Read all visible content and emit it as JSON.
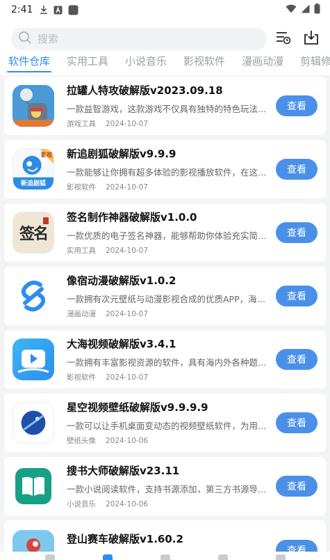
{
  "status": {
    "time": "2:41"
  },
  "search": {
    "placeholder": "搜索"
  },
  "tabs": [
    {
      "label": "软件仓库",
      "active": true
    },
    {
      "label": "实用工具"
    },
    {
      "label": "小说音乐"
    },
    {
      "label": "影视软件"
    },
    {
      "label": "漫画动漫"
    },
    {
      "label": "剪辑修"
    }
  ],
  "apps": [
    {
      "title": "拉罐人特攻破解版v2023.09.18",
      "desc": "一款益智游戏，这款游戏不仅具有独特的特色玩法…",
      "category": "游戏工具",
      "date": "2024-10-07",
      "button": "查看"
    },
    {
      "title": "新追剧狐破解版v9.9.9",
      "desc": "一款能够让你拥有超多体验的影视播放软件，在这…",
      "category": "影视软件",
      "date": "2024-10-07",
      "button": "查看",
      "icon_text": "新追剧狐",
      "badge": "影视"
    },
    {
      "title": "签名制作神器破解版v1.0.0",
      "desc": "一款优质的电子签名神器，能够帮助你体验充实简…",
      "category": "实用工具",
      "date": "2024-10-07",
      "button": "查看",
      "icon_text": "签名"
    },
    {
      "title": "像宿动漫破解版v1.0.2",
      "desc": "一款拥有次元壁纸与动漫影视合成的优质APP，海…",
      "category": "漫画动漫",
      "date": "2024-10-07",
      "button": "查看"
    },
    {
      "title": "大海视频破解版v3.4.1",
      "desc": "一款拥有丰富影视资源的软件，具有海内外各种题…",
      "category": "影视软件",
      "date": "2024-10-07",
      "button": "查看"
    },
    {
      "title": "星空视频壁纸破解版v9.9.9.9",
      "desc": "一款可以让手机桌面变动态的视频壁纸软件，为用…",
      "category": "壁纸头像",
      "date": "2024-10-06",
      "button": "查看"
    },
    {
      "title": "搜书大师破解版v23.11",
      "desc": "一款小说阅读软件，支持书源添加，第三方书源导…",
      "category": "小说音乐",
      "date": "2024-10-06",
      "button": "查看"
    },
    {
      "title": "登山赛车破解版v1.60.2",
      "desc": "",
      "category": "",
      "date": "",
      "button": "查看"
    }
  ]
}
